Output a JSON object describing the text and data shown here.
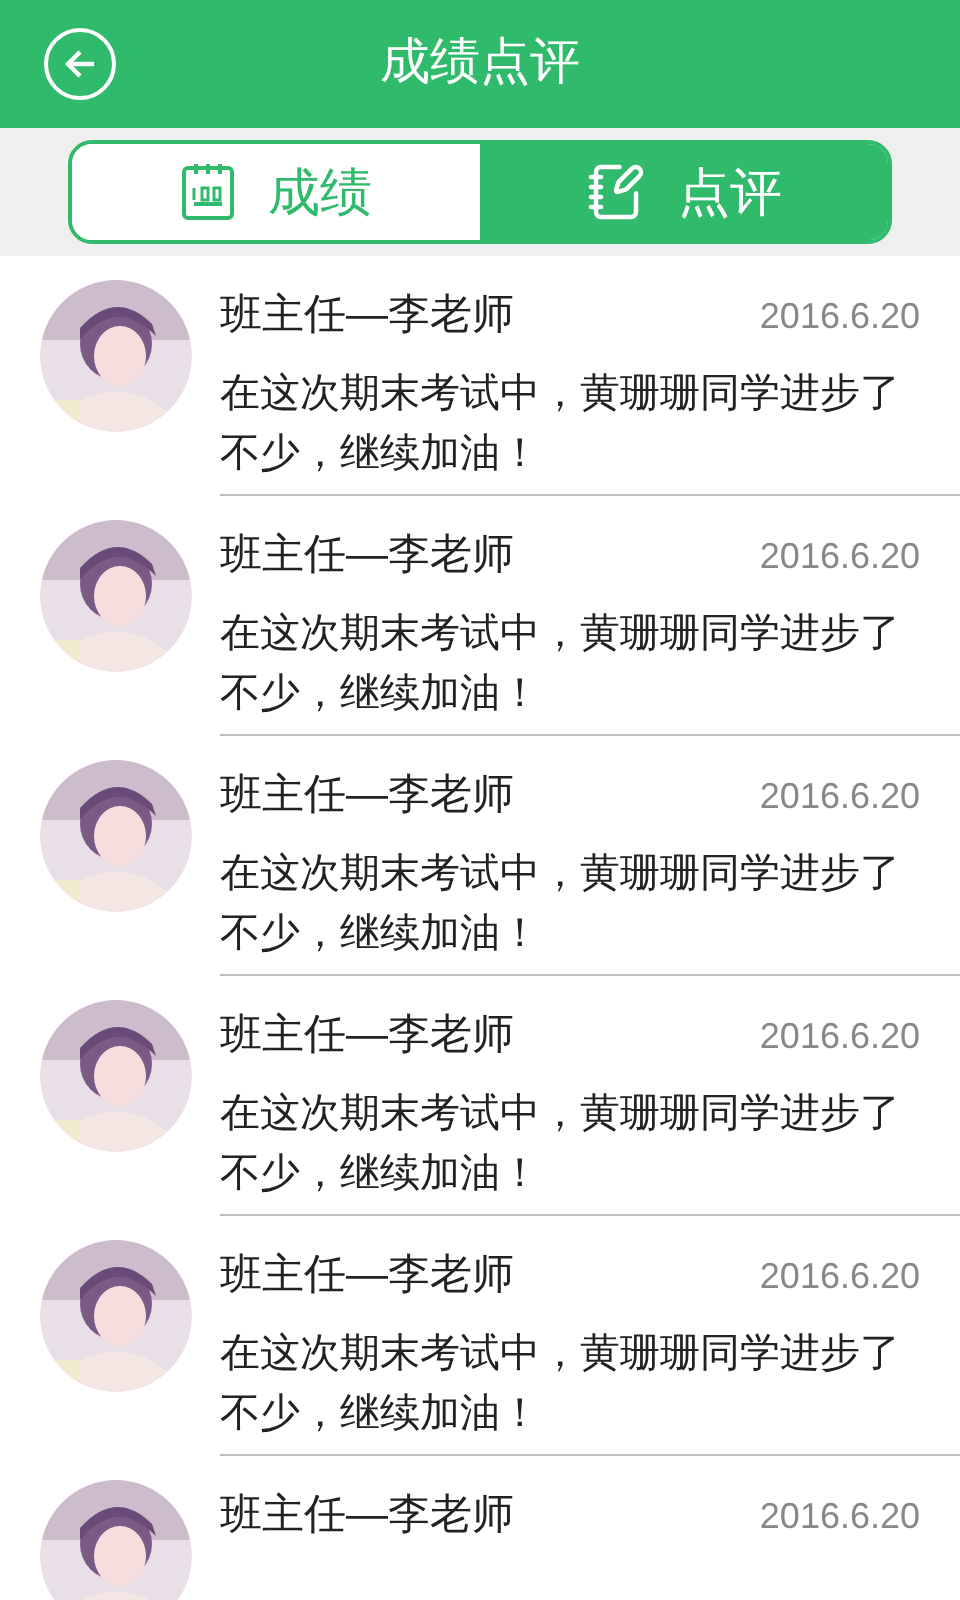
{
  "header": {
    "title": "成绩点评"
  },
  "tabs": [
    {
      "label": "成绩",
      "selected": false,
      "kind": "score"
    },
    {
      "label": "点评",
      "selected": true,
      "kind": "comment"
    }
  ],
  "comments": [
    {
      "author": "班主任—李老师",
      "date": "2016.6.20",
      "text": "在这次期末考试中，黄珊珊同学进步了不少，继续加油！"
    },
    {
      "author": "班主任—李老师",
      "date": "2016.6.20",
      "text": "在这次期末考试中，黄珊珊同学进步了不少，继续加油！"
    },
    {
      "author": "班主任—李老师",
      "date": "2016.6.20",
      "text": "在这次期末考试中，黄珊珊同学进步了不少，继续加油！"
    },
    {
      "author": "班主任—李老师",
      "date": "2016.6.20",
      "text": "在这次期末考试中，黄珊珊同学进步了不少，继续加油！"
    },
    {
      "author": "班主任—李老师",
      "date": "2016.6.20",
      "text": "在这次期末考试中，黄珊珊同学进步了不少，继续加油！"
    },
    {
      "author": "班主任—李老师",
      "date": "2016.6.20"
    }
  ]
}
